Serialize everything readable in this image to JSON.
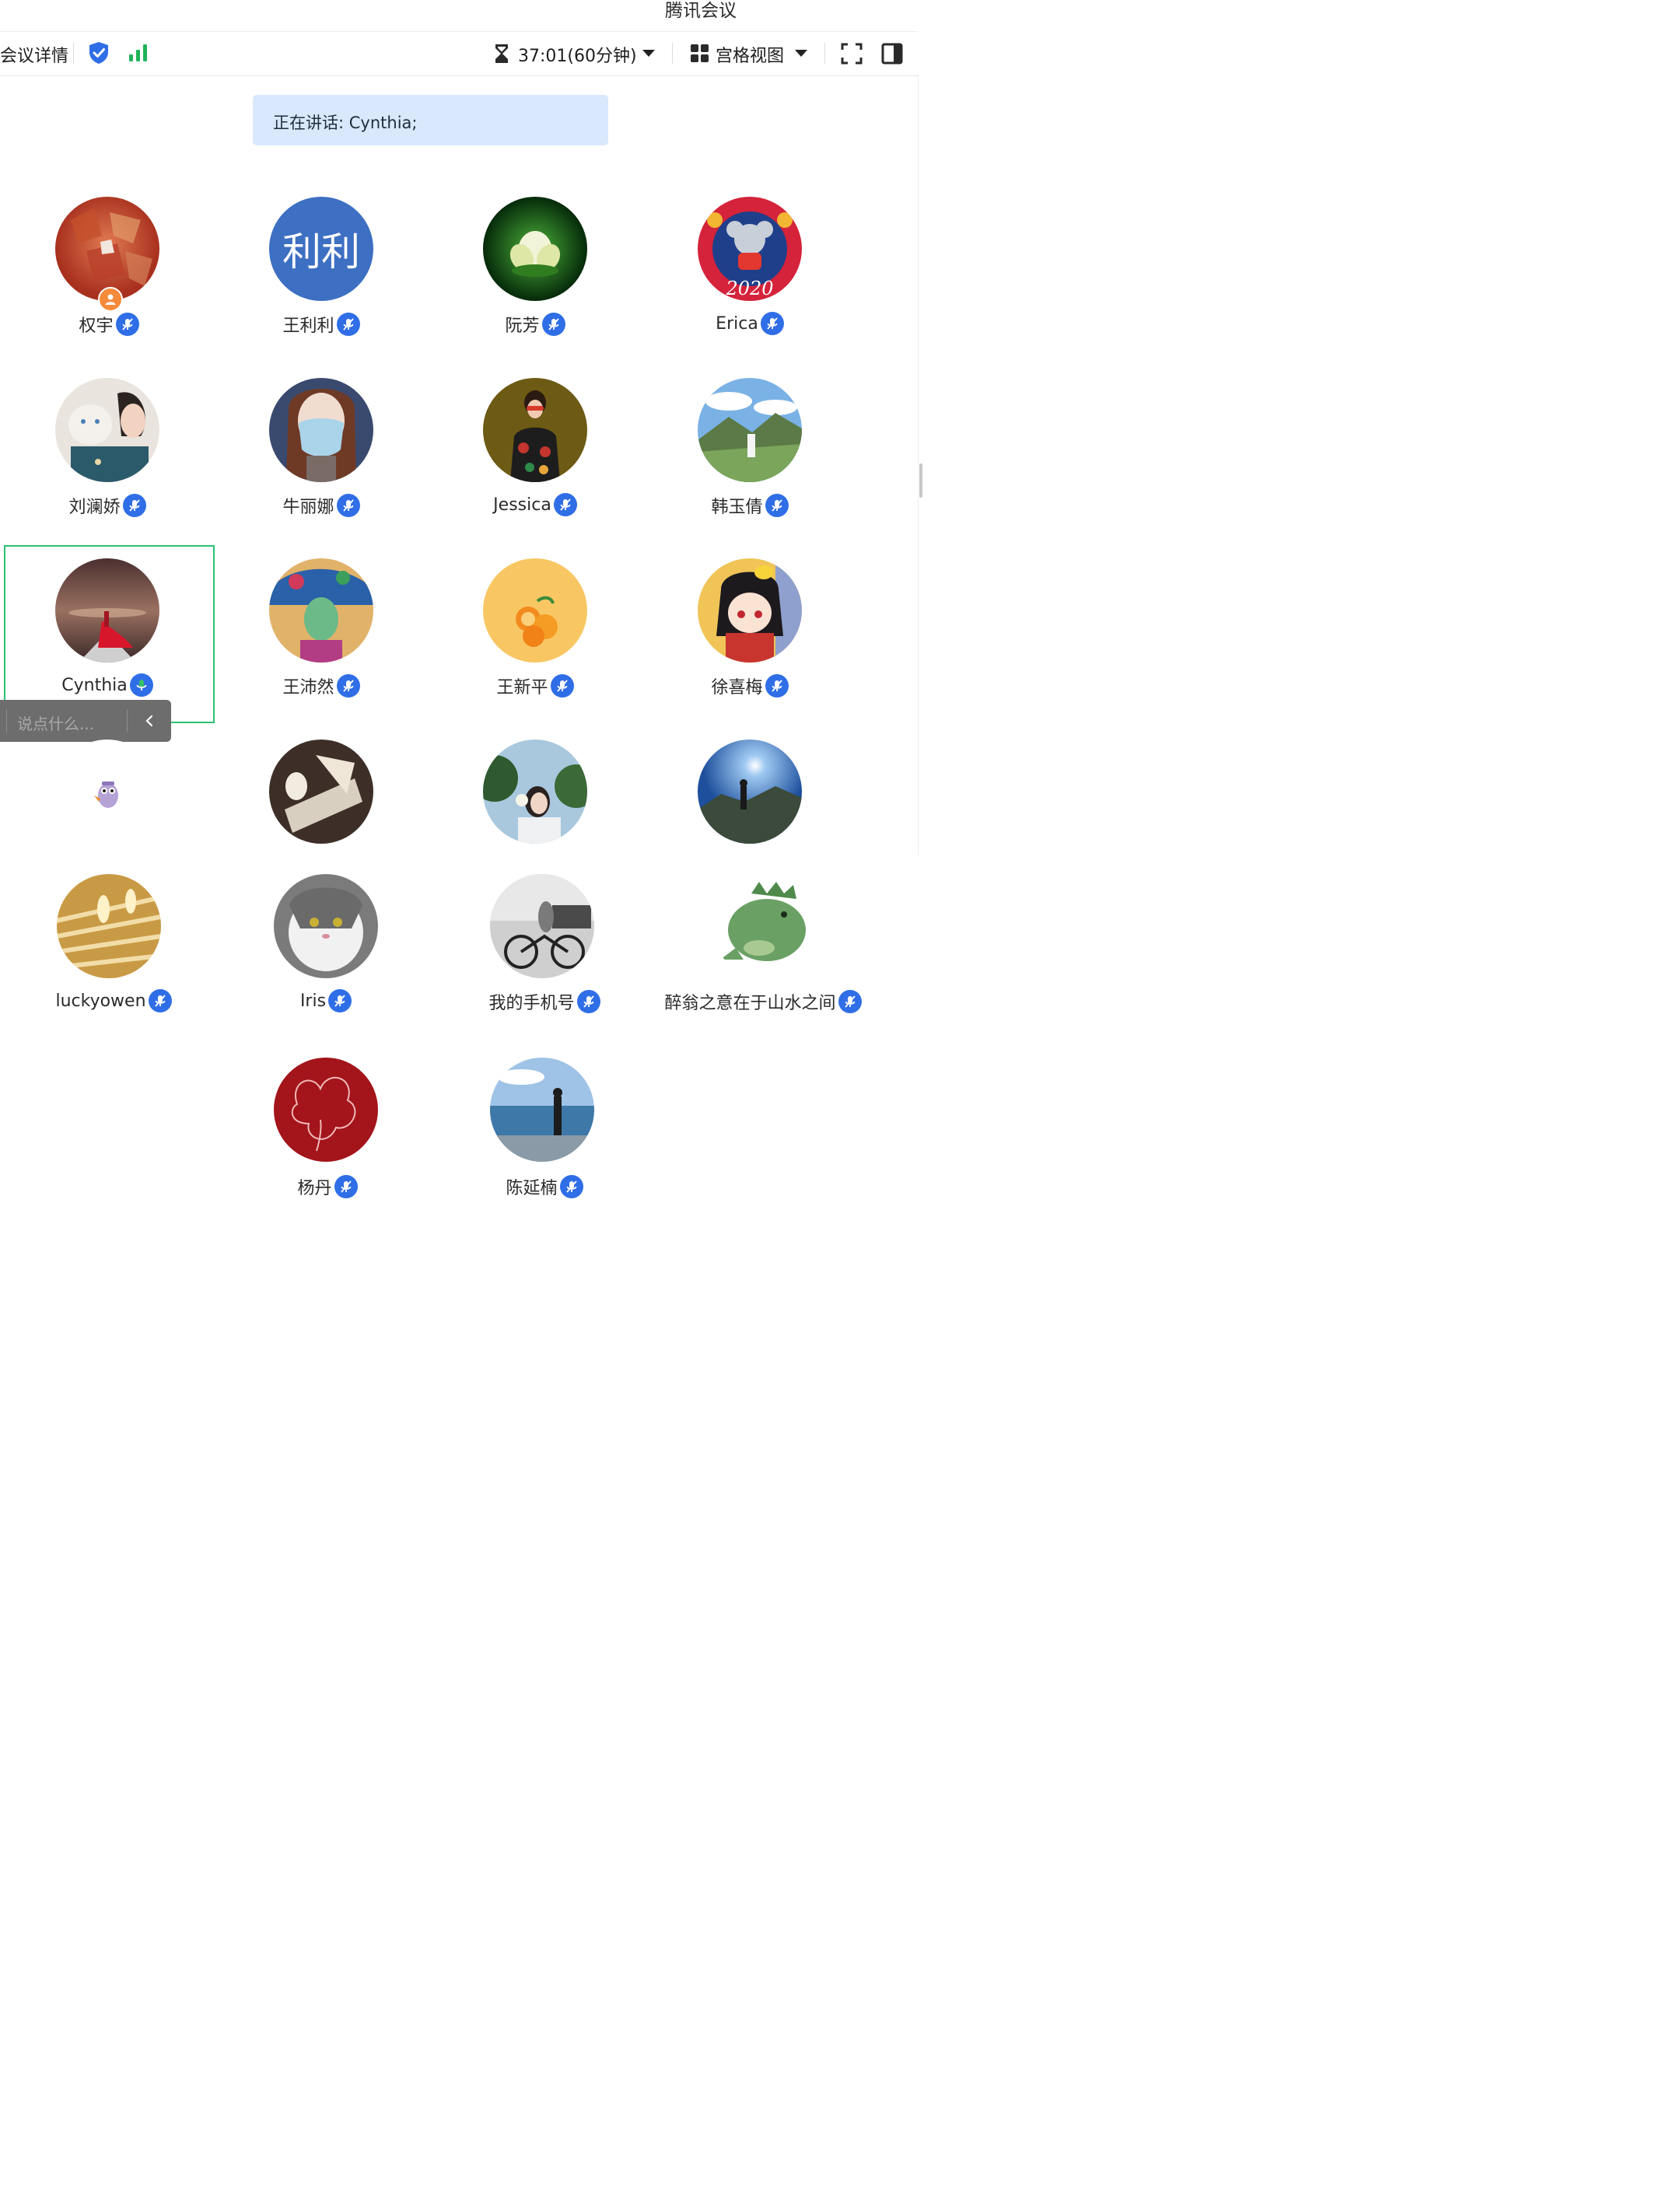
{
  "app_title": "腾讯会议",
  "toolbar": {
    "meeting_details": "会议详情",
    "timer": "37:01(60分钟)",
    "view_mode": "宫格视图"
  },
  "speaking": {
    "text": "正在讲话: Cynthia;"
  },
  "chat": {
    "placeholder": "说点什么..."
  },
  "participants": [
    {
      "name": "权宇",
      "role": "host"
    },
    {
      "name": "王利利",
      "avatar_text": "利利"
    },
    {
      "name": "阮芳"
    },
    {
      "name": "Erica",
      "avatar_text": "2020"
    },
    {
      "name": "刘澜娇"
    },
    {
      "name": "牛丽娜"
    },
    {
      "name": "Jessica"
    },
    {
      "name": "韩玉倩"
    },
    {
      "name": "Cynthia",
      "speaking": true
    },
    {
      "name": "王沛然"
    },
    {
      "name": "王新平"
    },
    {
      "name": "徐喜梅"
    },
    {
      "name": ""
    },
    {
      "name": ""
    },
    {
      "name": ""
    },
    {
      "name": ""
    },
    {
      "name": "luckyowen"
    },
    {
      "name": "Iris"
    },
    {
      "name": "我的手机号"
    },
    {
      "name": "醉翁之意在于山水之间"
    },
    {
      "name": "杨丹"
    },
    {
      "name": "陈延楠"
    }
  ],
  "colors": {
    "accent": "#2f6ee6",
    "speaking_frame": "#2cc271",
    "banner": "#d9e8fc"
  }
}
